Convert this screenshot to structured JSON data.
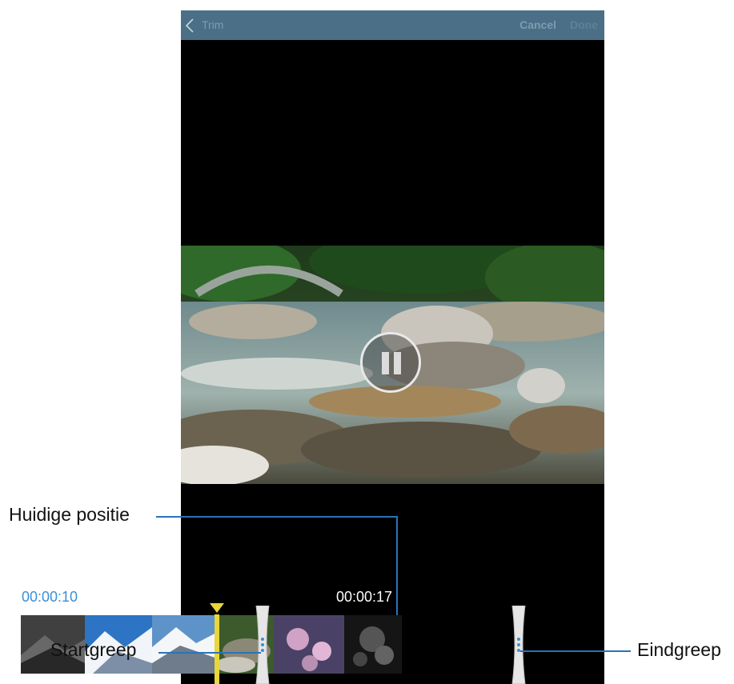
{
  "topbar": {
    "title": "Trim",
    "cancel_label": "Cancel",
    "done_label": "Done",
    "back_icon": "chevron-left-icon"
  },
  "player": {
    "state_icon": "pause-icon"
  },
  "trim": {
    "start_time": "00:00:10",
    "end_time": "00:00:17"
  },
  "callouts": {
    "current_position": "Huidige positie",
    "start_handle": "Startgreep",
    "end_handle": "Eindgreep"
  },
  "colors": {
    "topbar": "#4a6f86",
    "start_time": "#3b8fd6",
    "playhead": "#e8d63a",
    "leader_line": "#2a73b8"
  }
}
